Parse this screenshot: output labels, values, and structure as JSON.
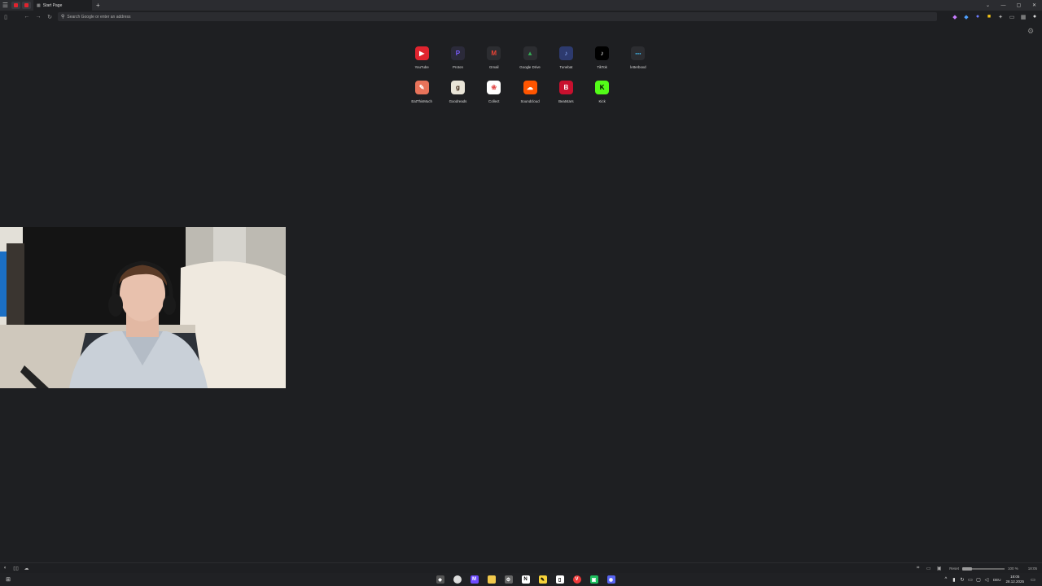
{
  "browser": {
    "tab_title": "Start Page",
    "new_tab": "+",
    "address_placeholder": "Search Google or enter an address"
  },
  "speed_dials": [
    {
      "label": "YouTube",
      "icon": "youtube-icon",
      "glyph": "▶",
      "bg": "#e0242f",
      "fg": "#ffffff"
    },
    {
      "label": "Proton",
      "icon": "proton-icon",
      "glyph": "P",
      "bg": "#2b2a3a",
      "fg": "#7b5cff"
    },
    {
      "label": "Gmail",
      "icon": "gmail-icon",
      "glyph": "M",
      "bg": "#2c2d31",
      "fg": "#ea4335"
    },
    {
      "label": "Google Drive",
      "icon": "google-drive-icon",
      "glyph": "▲",
      "bg": "#2c2d31",
      "fg": "#34a853"
    },
    {
      "label": "Tunebat",
      "icon": "tunebat-icon",
      "glyph": "♪",
      "bg": "#2d3a6e",
      "fg": "#8fb0ff"
    },
    {
      "label": "TikTok",
      "icon": "tiktok-icon",
      "glyph": "♪",
      "bg": "#000000",
      "fg": "#ffffff"
    },
    {
      "label": "letterboxd",
      "icon": "letterboxd-icon",
      "glyph": "●●●",
      "bg": "#2c2d31",
      "fg": "#40bcf4"
    },
    {
      "label": "EatThisMuch",
      "icon": "eatthismuch-icon",
      "glyph": "✎",
      "bg": "#e8735a",
      "fg": "#ffffff"
    },
    {
      "label": "Goodreads",
      "icon": "goodreads-icon",
      "glyph": "g",
      "bg": "#e9e5d8",
      "fg": "#382110"
    },
    {
      "label": "Collect",
      "icon": "collect-icon",
      "glyph": "❀",
      "bg": "#ffffff",
      "fg": "#e24a4a"
    },
    {
      "label": "Soundcloud",
      "icon": "soundcloud-icon",
      "glyph": "☁",
      "bg": "#ff5500",
      "fg": "#ffffff"
    },
    {
      "label": "Beatstars",
      "icon": "beatstars-icon",
      "glyph": "B",
      "bg": "#c8102e",
      "fg": "#ffffff"
    },
    {
      "label": "Kick",
      "icon": "kick-icon",
      "glyph": "K",
      "bg": "#53fc18",
      "fg": "#000000"
    }
  ],
  "statusbar": {
    "reset": "Reset",
    "zoom": "100 %",
    "time_right": "18:05"
  },
  "taskbar": {
    "language": "DEU",
    "time": "18:05",
    "date": "28.12.2025"
  },
  "colors": {
    "page_bg": "#1e1f22",
    "tabbar_bg": "#2b2c30",
    "accent": "#e0242f"
  }
}
